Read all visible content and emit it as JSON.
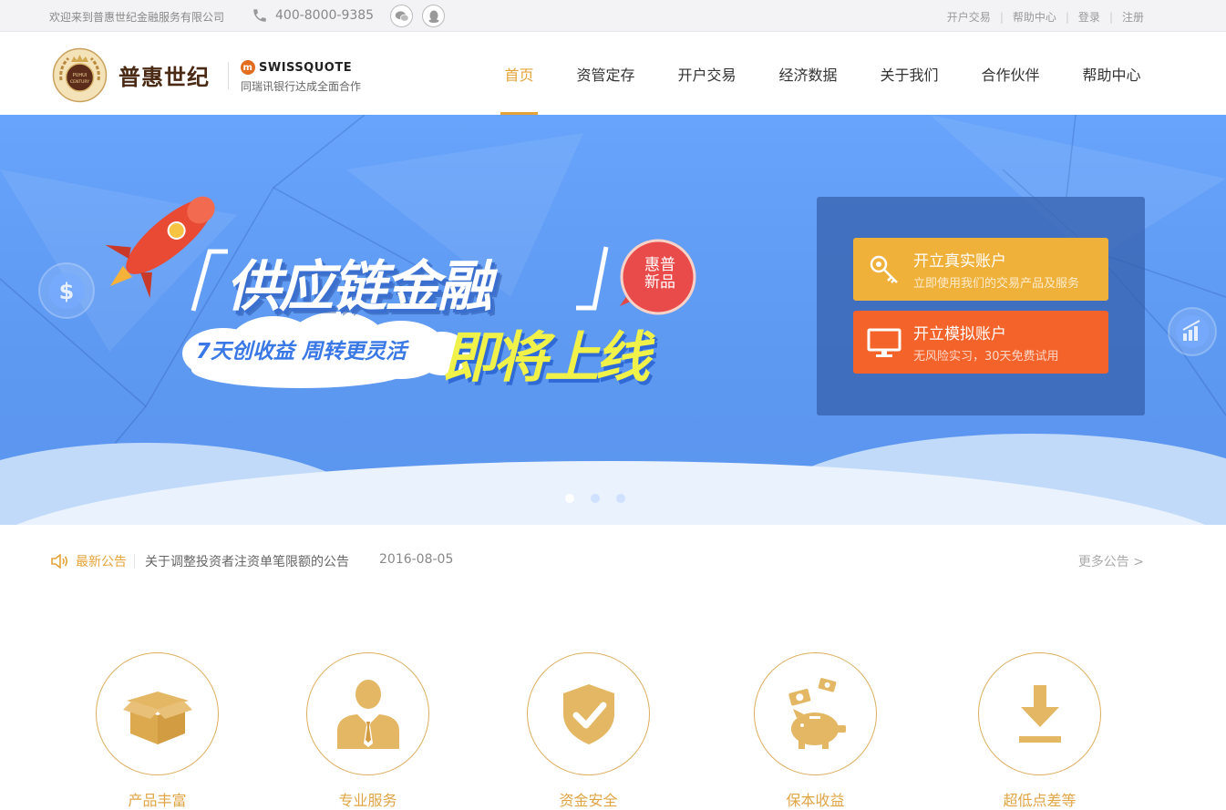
{
  "topbar": {
    "welcome": "欢迎来到普惠世纪金融服务有限公司",
    "phone": "400-8000-9385",
    "links": [
      "开户交易",
      "帮助中心",
      "登录",
      "注册"
    ]
  },
  "header": {
    "logo_text": "普惠世纪",
    "logo_badge_text": "PUHUI CENTURY",
    "partner_brand": "SWISSQUOTE",
    "partner_sub": "同瑞讯银行达成全面合作"
  },
  "nav": {
    "items": [
      "首页",
      "资管定存",
      "开户交易",
      "经济数据",
      "关于我们",
      "合作伙伴",
      "帮助中心"
    ],
    "active_index": 0
  },
  "banner": {
    "headline": "供应链金融",
    "badge": "惠普\n新品",
    "slogan": "7天创收益 周转更灵活",
    "launch": "即将上线",
    "slides_total": 3,
    "slide_active": 1
  },
  "cta": {
    "real_title": "开立真实账户",
    "real_sub": "立即使用我们的交易产品及服务",
    "demo_title": "开立模拟账户",
    "demo_sub": "无风险实习，30天免费试用"
  },
  "notice": {
    "label": "最新公告",
    "title": "关于调整投资者注资单笔限额的公告",
    "date": "2016-08-05",
    "more": "更多公告 >"
  },
  "features": [
    {
      "label": "产品丰富",
      "icon": "box-icon"
    },
    {
      "label": "专业服务",
      "icon": "person-icon"
    },
    {
      "label": "资金安全",
      "icon": "shield-icon"
    },
    {
      "label": "保本收益",
      "icon": "piggy-bank-icon"
    },
    {
      "label": "超低点差等",
      "icon": "download-icon"
    }
  ],
  "colors": {
    "accent": "#e5a43a",
    "banner_blue": "#5d98f1",
    "cta_real": "#f0b13a",
    "cta_demo": "#f3632a"
  }
}
